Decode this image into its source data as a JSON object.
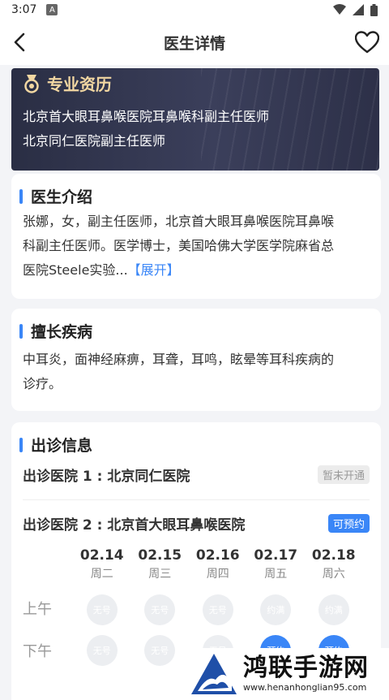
{
  "status_bar": {
    "time": "3:07",
    "badge": "A"
  },
  "nav": {
    "title": "医生详情"
  },
  "qualification": {
    "title": "专业资历",
    "lines": [
      "北京首大眼耳鼻喉医院耳鼻喉科副主任医师",
      "北京同仁医院副主任医师"
    ]
  },
  "intro": {
    "title": "医生介绍",
    "lines": [
      "张娜，女，副主任医师，北京首大眼耳鼻喉医院耳鼻喉",
      "科副主任医师。医学博士，美国哈佛大学医学院麻省总",
      "医院Steele实验..."
    ],
    "expand_label": "【展开】"
  },
  "specialty": {
    "title": "擅长疾病",
    "lines": [
      "中耳炎，面神经麻痹，耳聋，耳鸣，眩晕等耳科疾病的",
      "诊疗。"
    ]
  },
  "schedule": {
    "title": "出诊信息",
    "hospitals": [
      {
        "name": "出诊医院 1 : 北京同仁医院",
        "tag": "暂未开通"
      },
      {
        "name": "出诊医院 2 : 北京首大眼耳鼻喉医院",
        "tag": "可预约"
      }
    ],
    "dates": [
      {
        "date": "02.14",
        "weekday": "周二"
      },
      {
        "date": "02.15",
        "weekday": "周三"
      },
      {
        "date": "02.16",
        "weekday": "周四"
      },
      {
        "date": "02.17",
        "weekday": "周五"
      },
      {
        "date": "02.18",
        "weekday": "周六"
      }
    ],
    "morning_label": "上午",
    "afternoon_label": "下午",
    "morning": [
      "无号",
      "无号",
      "无号",
      "约满",
      "约满"
    ],
    "afternoon": [
      "无号",
      "无号",
      "无号",
      "预约",
      "预约"
    ]
  },
  "watermark": {
    "title": "鸿联手游网",
    "url": "www.henanhonglian95.com"
  },
  "colors": {
    "accent": "#3a86f7",
    "gold": "#f2d7a2",
    "card_dark": "#2a2e44"
  }
}
